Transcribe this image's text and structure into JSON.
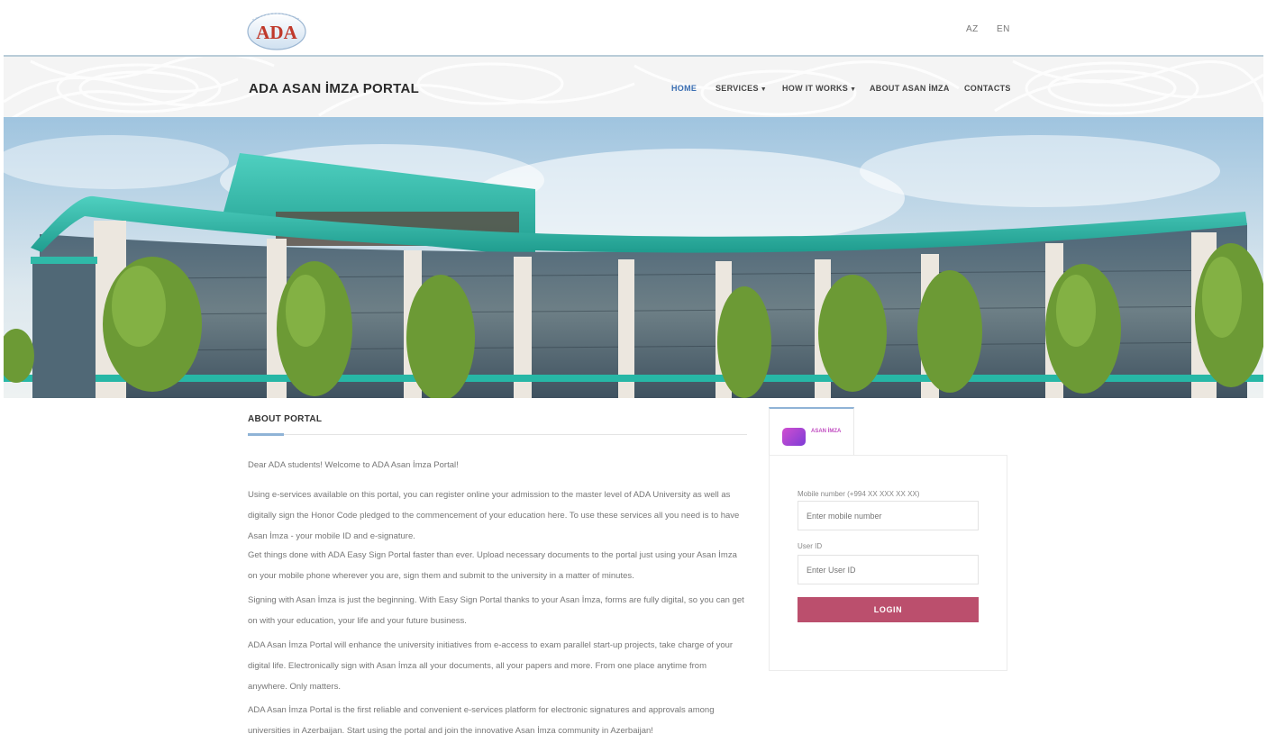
{
  "header": {
    "logo_text": "ADA",
    "languages": [
      "AZ",
      "EN"
    ]
  },
  "nav": {
    "site_title": "ADA ASAN İMZA PORTAL",
    "items": [
      {
        "label": "HOME",
        "has_dropdown": false,
        "active": true
      },
      {
        "label": "SERVICES",
        "has_dropdown": true,
        "active": false
      },
      {
        "label": "HOW IT WORKS",
        "has_dropdown": true,
        "active": false
      },
      {
        "label": "ABOUT ASAN İMZA",
        "has_dropdown": false,
        "active": false
      },
      {
        "label": "CONTACTS",
        "has_dropdown": false,
        "active": false
      }
    ]
  },
  "about": {
    "title": "ABOUT PORTAL",
    "paragraphs": [
      "Dear ADA students! Welcome to ADA Asan İmza Portal!",
      "Using e-services available on this portal, you can register online your admission to the master level of ADA University as well as digitally sign the Honor Code pledged to the commencement of your education here. To use these services all you need is to have Asan İmza - your mobile ID and e-signature.",
      "Get things done with ADA Easy Sign Portal faster than ever. Upload necessary documents to the portal just using your Asan İmza on your mobile phone wherever you are, sign them and submit to the university in a matter of minutes.",
      "Signing with Asan İmza is just the beginning. With Easy Sign Portal thanks to your Asan İmza, forms are fully digital, so you can get on with your education, your life and your future business.",
      "ADA Asan İmza Portal will enhance the university initiatives from e-access to exam parallel start-up projects, take charge of your digital life. Electronically sign with Asan İmza all your documents, all your papers and more. From one place anytime from anywhere. Only matters.",
      "ADA Asan İmza Portal is the first reliable and convenient e-services platform for electronic signatures and approvals among universities in Azerbaijan. Start using the portal and join the innovative Asan İmza community in Azerbaijan!"
    ]
  },
  "login": {
    "tab_label": "ASAN İMZA",
    "mobile_label": "Mobile number (+994 XX XXX XX XX)",
    "mobile_placeholder": "Enter mobile number",
    "userid_label": "User ID",
    "userid_placeholder": "Enter User ID",
    "button_label": "LOGIN"
  },
  "colors": {
    "accent_blue": "#3b6fb3",
    "login_button": "#bb4f6d",
    "tab_icon": "#b04ad3",
    "building_roof": "#2fb9a8"
  }
}
